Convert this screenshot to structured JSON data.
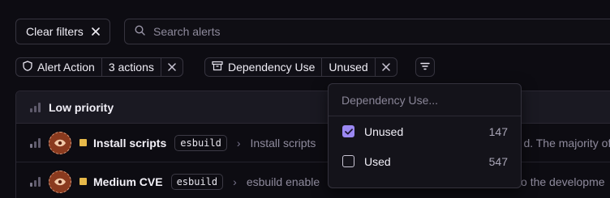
{
  "toolbar": {
    "clear_filters_label": "Clear filters",
    "search_placeholder": "Search alerts"
  },
  "chips": {
    "alert_action": {
      "label": "Alert Action",
      "value": "3 actions"
    },
    "dependency_use": {
      "label": "Dependency Use",
      "value": "Unused"
    }
  },
  "group": {
    "label": "Low priority"
  },
  "alerts": [
    {
      "title": "Install scripts",
      "package": "esbuild",
      "description": "Install scripts",
      "description_tail": "d. The majority of"
    },
    {
      "title": "Medium CVE",
      "package": "esbuild",
      "description": "esbuild enable",
      "description_tail": "to the developme"
    }
  ],
  "dropdown": {
    "search_placeholder": "Dependency Use...",
    "options": [
      {
        "label": "Unused",
        "count": "147",
        "checked": true
      },
      {
        "label": "Used",
        "count": "547",
        "checked": false
      }
    ]
  },
  "colors": {
    "accent": "#9b88f2",
    "severity_medium": "#e7b94a",
    "avatar_bg": "#8a3a1e"
  }
}
